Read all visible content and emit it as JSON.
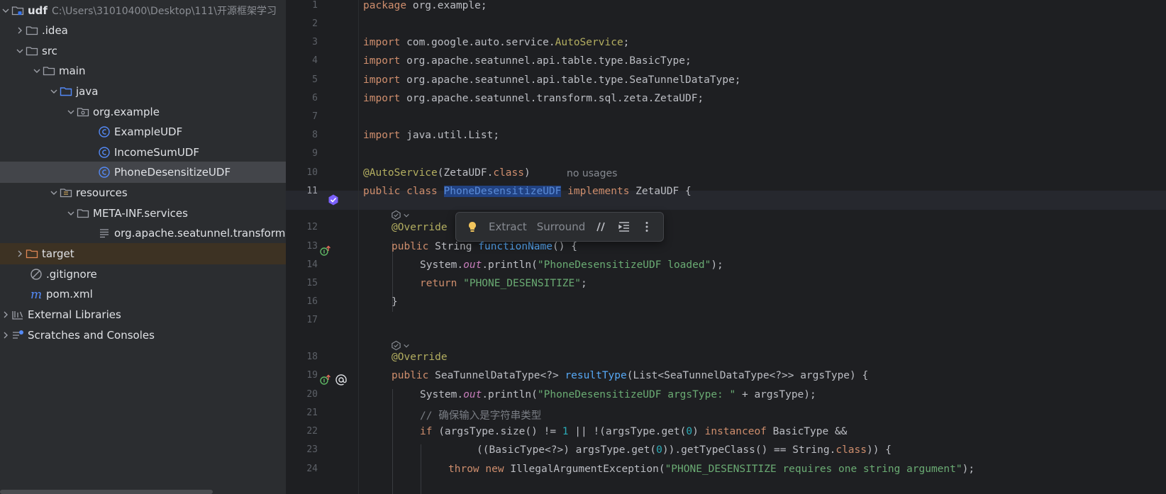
{
  "project_tree": {
    "root": {
      "name": "udf",
      "path": "C:\\Users\\31010400\\Desktop\\111\\开源框架学习"
    },
    "items": [
      {
        "label": ".idea"
      },
      {
        "label": "src"
      },
      {
        "label": "main"
      },
      {
        "label": "java"
      },
      {
        "label": "org.example"
      },
      {
        "label": "ExampleUDF"
      },
      {
        "label": "IncomeSumUDF"
      },
      {
        "label": "PhoneDesensitizeUDF"
      },
      {
        "label": "resources"
      },
      {
        "label": "META-INF.services"
      },
      {
        "label": "org.apache.seatunnel.transform.sql.zeta.ZetaUDF"
      },
      {
        "label": "target"
      },
      {
        "label": ".gitignore"
      },
      {
        "label": "pom.xml"
      },
      {
        "label": "External Libraries"
      },
      {
        "label": "Scratches and Consoles"
      }
    ]
  },
  "editor": {
    "line_numbers": [
      "1",
      "2",
      "3",
      "4",
      "5",
      "6",
      "7",
      "8",
      "9",
      "10",
      "11",
      "12",
      "13",
      "14",
      "15",
      "16",
      "17",
      "18",
      "19",
      "20",
      "21",
      "22",
      "23",
      "24"
    ],
    "tokens": {
      "package": "package",
      "pkg_name": " org.example;",
      "import": "import",
      "imp1_a": " com.google.auto.service.",
      "imp1_b": "AutoService",
      "imp1_c": ";",
      "imp2": " org.apache.seatunnel.api.table.type.BasicType;",
      "imp3": " org.apache.seatunnel.api.table.type.SeaTunnelDataType;",
      "imp4": " org.apache.seatunnel.transform.sql.zeta.ZetaUDF;",
      "imp5": " java.util.List;",
      "auto_service_ann": "@AutoService",
      "auto_service_args_a": "(ZetaUDF.",
      "class_kw": "class",
      "auto_service_args_b": ")",
      "no_usages": "no usages",
      "public": "public",
      "class_name": "PhoneDesensitizeUDF",
      "implements": "implements",
      "zeta_udf": " ZetaUDF {",
      "override": "@Override",
      "string_type": " String ",
      "function_name": "functionName",
      "fn_tail": "() {",
      "system": "System.",
      "out": "out",
      "println": ".println(",
      "str_loaded": "\"PhoneDesensitizeUDF loaded\"",
      "close_paren": ");",
      "return": "return",
      "str_phone": " \"PHONE_DESENSITIZE\"",
      "semicolon": ";",
      "close_brace": "}",
      "seatunnel_type": " SeaTunnelDataType<?> ",
      "result_type": "resultType",
      "rt_tail": "(List<SeaTunnelDataType<?>> argsType) {",
      "str_args": "\"PhoneDesensitizeUDF argsType: \"",
      "plus_args": " + argsType);",
      "comment": "// 确保输入是字符串类型",
      "if": "if",
      "if_a": " (argsType.size() != ",
      "one": "1",
      "if_b": " || !(argsType.get(",
      "zero": "0",
      "if_c": ") ",
      "instanceof": "instanceof",
      "if_d": " BasicType &&",
      "l23_a": "((BasicType<?>) argsType.get(",
      "l23_b": ")).getTypeClass() == String.",
      "l23_c": ")) {",
      "throw": "throw",
      "new": "new",
      "ex_name": " IllegalArgumentException(",
      "str_err": "\"PHONE_DESENSITIZE requires one string argument\""
    }
  },
  "floating_toolbar": {
    "extract": "Extract",
    "surround": "Surround"
  },
  "colors": {
    "keyword": "#cf8e6d",
    "annotation": "#b3ae60",
    "string": "#6aab73",
    "function": "#56a8f5",
    "number": "#2aacb8",
    "static_field": "#c77dbb",
    "comment": "#7a7e85",
    "selection": "#214283"
  }
}
